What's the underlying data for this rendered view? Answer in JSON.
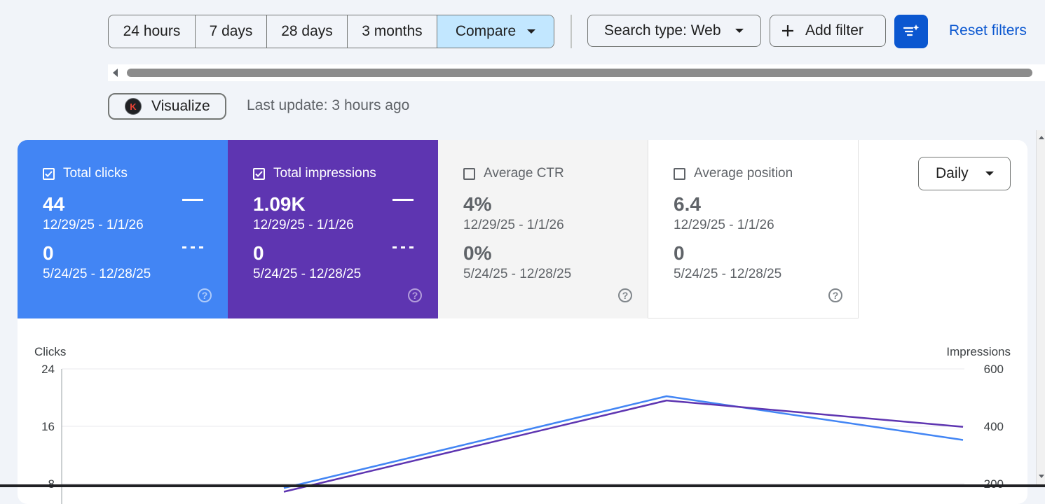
{
  "filters": {
    "ranges": [
      {
        "label": "24 hours"
      },
      {
        "label": "7 days"
      },
      {
        "label": "28 days"
      },
      {
        "label": "3 months"
      }
    ],
    "compare_label": "Compare",
    "search_type_label": "Search type: Web",
    "add_filter_label": "Add filter",
    "reset_label": "Reset filters"
  },
  "visualize": {
    "button_label": "Visualize",
    "logo_letter": "K",
    "last_update": "Last update: 3 hours ago"
  },
  "metrics": {
    "clicks": {
      "label": "Total clicks",
      "value": "44",
      "range": "12/29/25 - 1/1/26",
      "compare_value": "0",
      "compare_range": "5/24/25 - 12/28/25",
      "checked": true,
      "color": "#4285f4"
    },
    "impressions": {
      "label": "Total impressions",
      "value": "1.09K",
      "range": "12/29/25 - 1/1/26",
      "compare_value": "0",
      "compare_range": "5/24/25 - 12/28/25",
      "checked": true,
      "color": "#5e35b1"
    },
    "ctr": {
      "label": "Average CTR",
      "value": "4%",
      "range": "12/29/25 - 1/1/26",
      "compare_value": "0%",
      "compare_range": "5/24/25 - 12/28/25",
      "checked": false
    },
    "position": {
      "label": "Average position",
      "value": "6.4",
      "range": "12/29/25 - 1/1/26",
      "compare_value": "0",
      "compare_range": "5/24/25 - 12/28/25",
      "checked": false
    }
  },
  "granularity": {
    "label": "Daily"
  },
  "help_glyph": "?",
  "chart_data": {
    "type": "line",
    "ylabel": "Clicks",
    "y2label": "Impressions",
    "ylim": [
      0,
      24
    ],
    "y2lim": [
      0,
      600
    ],
    "yticks": [
      8,
      16,
      24
    ],
    "y2ticks": [
      200,
      400,
      600
    ],
    "ytick_labels": [
      "8",
      "16",
      "24"
    ],
    "y2tick_labels": [
      "200",
      "400",
      "600"
    ],
    "series": [
      {
        "name": "Total clicks",
        "axis": "left",
        "color": "#4285f4",
        "values": [
          7.4,
          20.2,
          14.1
        ]
      },
      {
        "name": "Total impressions",
        "axis": "right",
        "color": "#5e35b1",
        "values": [
          172,
          490,
          398
        ]
      }
    ]
  }
}
